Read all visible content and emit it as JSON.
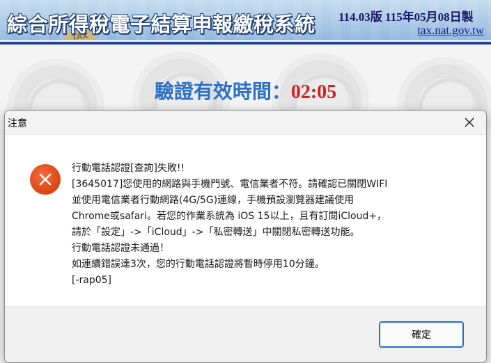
{
  "header": {
    "title": "綜合所得稅電子結算申報繳稅系統",
    "version": "114.03版 115年05月08日製",
    "site": "tax.nat.gov.tw",
    "badge": "TAX"
  },
  "timer": {
    "label": "驗證有效時間：",
    "value": "02:05"
  },
  "dialog": {
    "title": "注意",
    "icon": "error-icon",
    "lines": [
      "行動電話認證[查詢]失敗!!",
      "[3645017]您使用的網路與手機門號、電信業者不符。請確認已關閉WIFI",
      "並使用電信業者行動網路(4G/5G)連線，手機預設瀏覽器建議使用",
      "Chrome或safari。若您的作業系統為 iOS 15以上，且有訂閱iCloud+，",
      "請於「設定」->「iCloud」->「私密轉送」中關閉私密轉送功能。",
      "行動電話認證未通過！",
      "如連續錯誤達3次，您的行動電話認證將暫時停用10分鐘。",
      "[-rap05]"
    ],
    "ok_label": "確定"
  },
  "colors": {
    "banner": "#a9c8e6",
    "accent_line": "#1f3f9a",
    "timer_label": "#2a6fc9",
    "timer_value": "#d42020",
    "error_icon": "#e0481c",
    "button_border": "#1e6fd0"
  }
}
